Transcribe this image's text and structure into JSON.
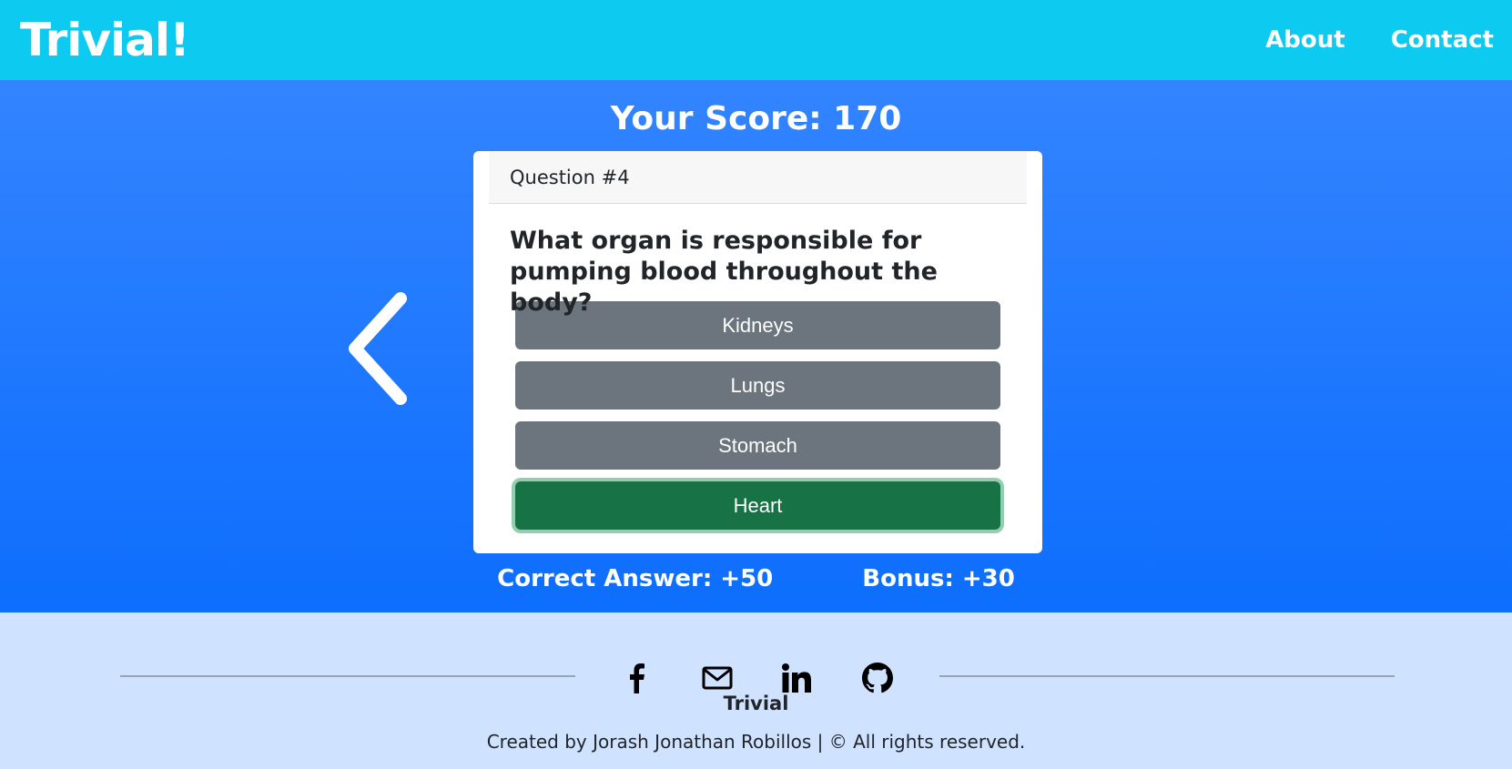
{
  "nav": {
    "brand": "Trivial!",
    "links": [
      "About",
      "Contact"
    ]
  },
  "score": {
    "text": "Your Score: 170"
  },
  "question_card": {
    "header": "Question #4",
    "question": "What organ is responsible for pumping blood throughout the body?",
    "answers": [
      {
        "label": "Kidneys",
        "state": "default"
      },
      {
        "label": "Lungs",
        "state": "default"
      },
      {
        "label": "Stomach",
        "state": "default"
      },
      {
        "label": "Heart",
        "state": "correct"
      }
    ]
  },
  "points": {
    "correct": "Correct Answer: +50",
    "bonus": "Bonus: +30"
  },
  "footer": {
    "social_icons": [
      "facebook-icon",
      "mail-icon",
      "linkedin-icon",
      "github-icon"
    ],
    "title": "Trivial",
    "credit": "Created by Jorash Jonathan Robillos | © All rights reserved."
  },
  "colors": {
    "navbar": "#0dcaf0",
    "main_top": "#3384ff",
    "main_bottom": "#0d6efd",
    "answer_default": "#6c757d",
    "answer_correct": "#177245",
    "footer": "#cfe2ff"
  }
}
